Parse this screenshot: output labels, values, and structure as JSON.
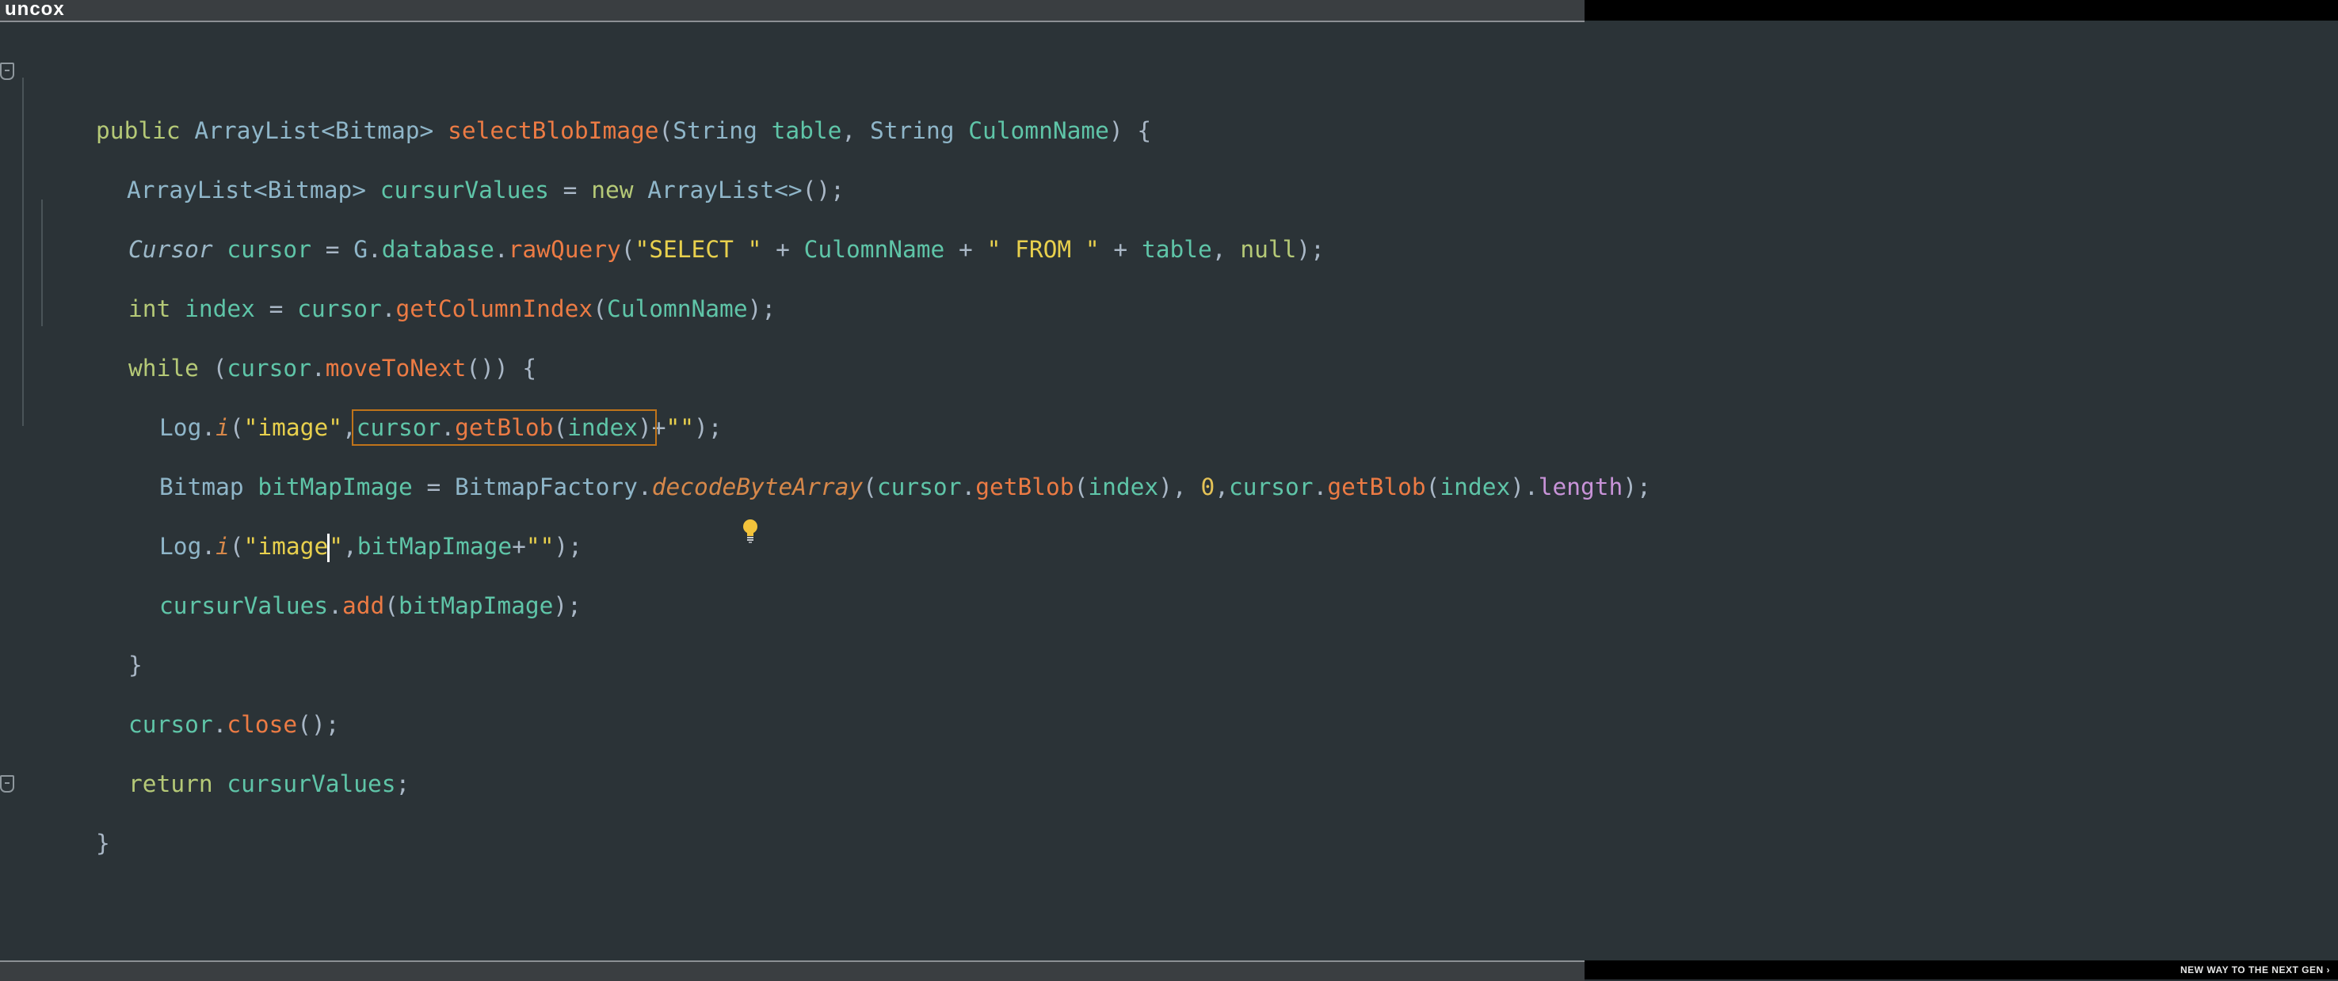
{
  "brand": "uncox",
  "tagline": "NEW WAY TO THE NEXT GEN",
  "code": {
    "l1": {
      "a": "public ",
      "b": "ArrayList<Bitmap> ",
      "c": "selectBlobImage",
      "d": "(",
      "e": "String ",
      "f": "table",
      "g": ", ",
      "h": "String ",
      "i": "CulomnName",
      "j": ") {"
    },
    "l2": {
      "a": "ArrayList<Bitmap> ",
      "b": "cursurValues",
      "c": " = ",
      "d": "new ",
      "e": "ArrayList<>",
      "f": "();"
    },
    "l3": {
      "a": "Cursor",
      "b": " ",
      "c": "cursor",
      "d": " = ",
      "e": "G",
      "f": ".",
      "g": "database",
      "h": ".",
      "i": "rawQuery",
      "j": "(",
      "k": "\"SELECT \"",
      "l": " + ",
      "m": "CulomnName",
      "n": " + ",
      "o": "\" FROM \"",
      "p": " + ",
      "q": "table",
      "r": ", ",
      "s": "null",
      "t": ");"
    },
    "l4": {
      "a": "int ",
      "b": "index",
      "c": " = ",
      "d": "cursor",
      "e": ".",
      "f": "getColumnIndex",
      "g": "(",
      "h": "CulomnName",
      "i": ");"
    },
    "l5": {
      "a": "while ",
      "b": "(",
      "c": "cursor",
      "d": ".",
      "e": "moveToNext",
      "f": "()) {"
    },
    "l6": {
      "a": "Log",
      "b": ".",
      "c": "i",
      "d": "(",
      "e": "\"image\"",
      "f": ",",
      "g": "cursor",
      "h": ".",
      "i": "getBlob",
      "j": "(",
      "k": "index",
      "l": ")",
      "m": "+",
      "n": "\"\"",
      "o": ");"
    },
    "l7": {
      "a": "Bitmap ",
      "b": "bitMapImage",
      "c": " = ",
      "d": "BitmapFactory",
      "e": ".",
      "f": "decodeByteArray",
      "g": "(",
      "h": "cursor",
      "i": ".",
      "j": "getBlob",
      "k": "(",
      "l": "index",
      "m": "), ",
      "n": "0",
      "o": ",",
      "p": "cursor",
      "q": ".",
      "r": "getBlob",
      "s": "(",
      "t": "index",
      "u": ").",
      "v": "length",
      "w": ");"
    },
    "l8": {
      "a": "Log",
      "b": ".",
      "c": "i",
      "d": "(",
      "e": "\"image",
      "e2": "\"",
      "f": ",",
      "g": "bitMapImage",
      "h": "+",
      "i": "\"\"",
      "j": ");"
    },
    "l9": {
      "a": "cursurValues",
      "b": ".",
      "c": "add",
      "d": "(",
      "e": "bitMapImage",
      "f": ");"
    },
    "l10": {
      "a": "}"
    },
    "l11": {
      "a": "cursor",
      "b": ".",
      "c": "close",
      "d": "();"
    },
    "l12": {
      "a": "return ",
      "b": "cursurValues",
      "c": ";"
    },
    "l13": {
      "a": "}"
    }
  },
  "icons": {
    "gutter_fold": "fold-marker-icon",
    "intention": "lightbulb-icon"
  },
  "colors": {
    "background": "#2b3337",
    "keyword": "#b5c977",
    "string": "#e8d04d",
    "method": "#ec7b44",
    "variable": "#5fc5a8",
    "highlight": "#c0741a"
  }
}
